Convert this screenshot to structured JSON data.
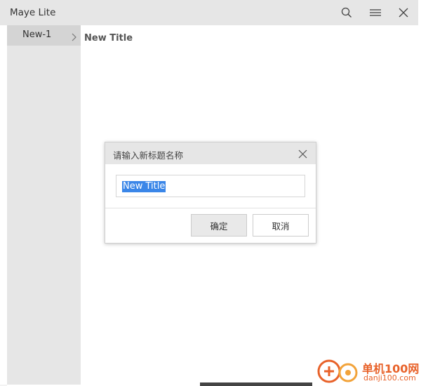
{
  "window": {
    "title": "Maye Lite"
  },
  "titlebar_icons": [
    "search-icon",
    "menu-icon",
    "close-icon"
  ],
  "sidebar": {
    "items": [
      {
        "label": "New-1",
        "selected": true
      }
    ]
  },
  "main": {
    "title": "New Title"
  },
  "dialog": {
    "title": "请输入新标题名称",
    "input_value": "New Title",
    "ok_label": "确定",
    "cancel_label": "取消"
  },
  "watermark": {
    "text": "单机100网",
    "sub": "danji100.com"
  },
  "colors": {
    "accent": "#3a86e8",
    "titlebar": "#e6e6e6",
    "sidebar_selected": "#d4d4d4",
    "watermark": "#e8622a"
  }
}
